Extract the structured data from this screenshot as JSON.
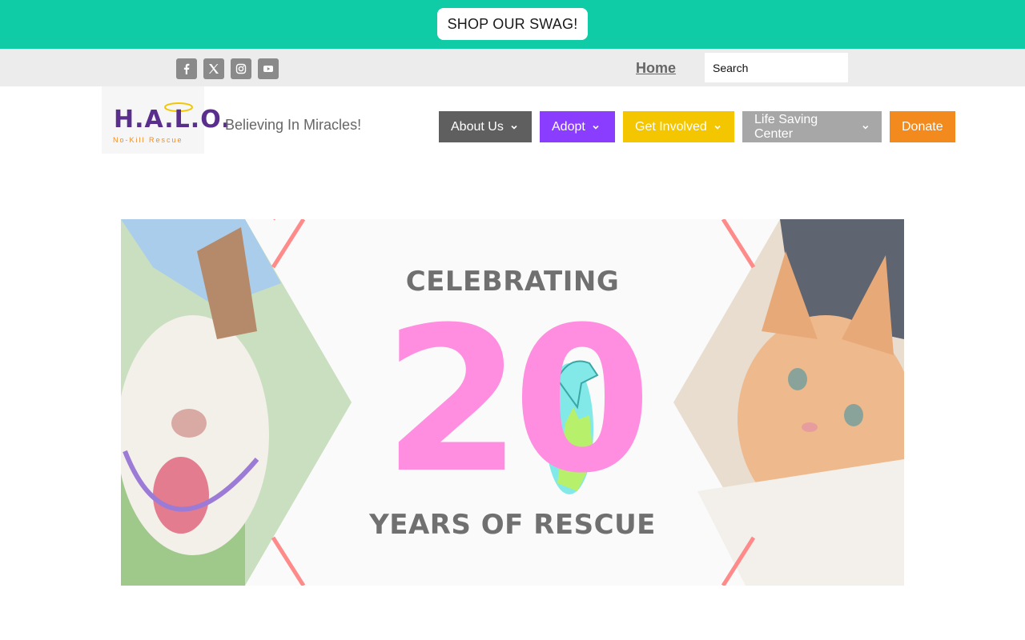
{
  "promo": {
    "shop_label": "SHOP OUR SWAG!"
  },
  "topbar": {
    "social": [
      {
        "name": "facebook-icon"
      },
      {
        "name": "x-icon"
      },
      {
        "name": "instagram-icon"
      },
      {
        "name": "youtube-icon"
      }
    ],
    "home_label": "Home",
    "search_placeholder": "Search"
  },
  "header": {
    "logo_text": "H.A.L.O.",
    "logo_sub": "No-Kill Rescue",
    "tagline": "Believing In Miracles!"
  },
  "nav": {
    "items": [
      {
        "label": "About Us",
        "color": "#5f5f5f",
        "has_dropdown": true
      },
      {
        "label": "Adopt",
        "color": "#8b3dff",
        "has_dropdown": true
      },
      {
        "label": "Get Involved",
        "color": "#f3c600",
        "has_dropdown": true
      },
      {
        "label": "Life Saving Center",
        "color": "#a7a7a7",
        "has_dropdown": true
      },
      {
        "label": "Donate",
        "color": "#f28a1e",
        "has_dropdown": false
      }
    ]
  },
  "hero": {
    "title": "CELEBRATING",
    "number": "20",
    "subtitle": "YEARS OF RESCUE"
  },
  "colors": {
    "promo_bg": "#10cca6",
    "topbar_bg": "#ececec",
    "hero_pink": "#ff8ee0"
  }
}
